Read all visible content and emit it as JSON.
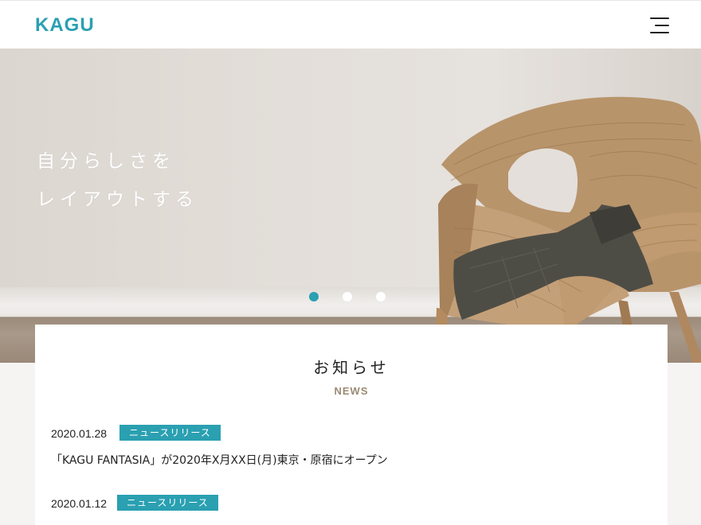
{
  "header": {
    "logo_text": "KAGU",
    "menu_icon": "hamburger-menu-icon"
  },
  "hero": {
    "copy_line1": "自分らしさを",
    "copy_line2": "レイアウトする",
    "image_icon": "wicker-chair-image",
    "slides": 3,
    "active_slide": 1,
    "accent_color": "#2aa0b1"
  },
  "news": {
    "title": "お知らせ",
    "subtitle": "NEWS",
    "items": [
      {
        "date": "2020.01.28",
        "category": "ニュースリリース",
        "headline": "「KAGU FANTASIA」が2020年X月XX日(月)東京・原宿にオープン"
      },
      {
        "date": "2020.01.12",
        "category": "ニュースリリース",
        "headline": ""
      }
    ]
  }
}
